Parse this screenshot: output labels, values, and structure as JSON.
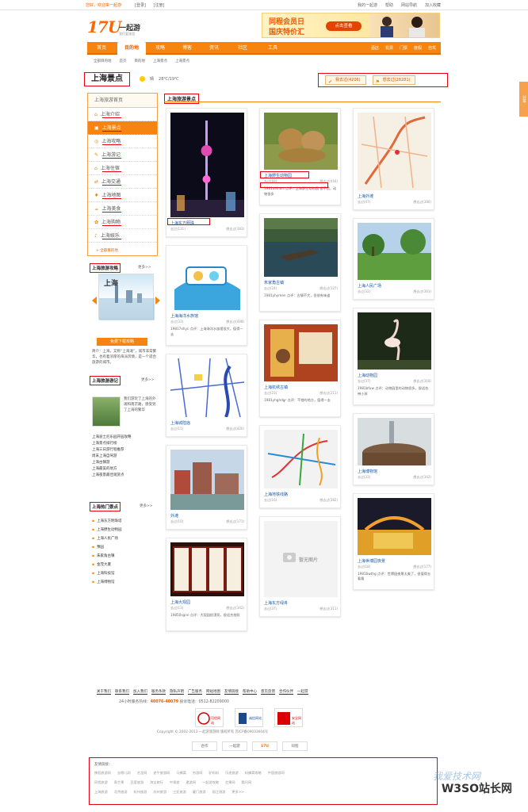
{
  "topbar": {
    "greeting": "您好，欢迎来一起游",
    "login": "[登录]",
    "register": "[注册]",
    "right_links": [
      "我的一起游",
      "帮助",
      "网站导航",
      "加入收藏"
    ]
  },
  "logo": {
    "num": "17U",
    "cn": "一起游",
    "sub": "我们爱旅游"
  },
  "ad": {
    "line1": "同程会员日",
    "line2": "国庆特价汇",
    "button": "点击查看"
  },
  "nav": {
    "items": [
      "首页",
      "目的地",
      "攻略",
      "博客",
      "资讯",
      "社区",
      "工具"
    ],
    "active": 1,
    "right_links": [
      "酒店",
      "机票",
      "门票",
      "度假",
      "自驾"
    ]
  },
  "breadcrumb": [
    "全部目的地",
    "首页",
    "目的地",
    "上海景点",
    "上海景点"
  ],
  "page_title": "上海景点",
  "weather": {
    "label": "晴",
    "temp": "28℃/19℃"
  },
  "actions": {
    "been": "我去过(4206)",
    "want": "想去过(28281)"
  },
  "sidebar": {
    "head": "上海旅游首页",
    "items": [
      {
        "icon": "home-icon",
        "glyph": "⌂",
        "label": "上海介绍"
      },
      {
        "icon": "camera-icon",
        "glyph": "▣",
        "label": "上海景点"
      },
      {
        "icon": "guide-icon",
        "glyph": "◎",
        "label": "上海攻略"
      },
      {
        "icon": "journal-icon",
        "glyph": "✎",
        "label": "上海游记"
      },
      {
        "icon": "hotel-icon",
        "glyph": "⌂",
        "label": "上海住宿"
      },
      {
        "icon": "transport-icon",
        "glyph": "⇄",
        "label": "上海交通"
      },
      {
        "icon": "map-pin-icon",
        "glyph": "♦",
        "label": "上海地图"
      },
      {
        "icon": "food-icon",
        "glyph": "☕",
        "label": "上海美食"
      },
      {
        "icon": "shopping-icon",
        "glyph": "✿",
        "label": "上海购物"
      },
      {
        "icon": "entertainment-icon",
        "glyph": "♪",
        "label": "上海娱乐"
      }
    ],
    "active": 1,
    "more": "+ 全部目的地"
  },
  "guide": {
    "title": "上海旅游攻略",
    "more": "更多>>",
    "cover_text": "上海",
    "download": "免费下载攻略",
    "desc": "简介：上海，又称“上海滩”，城市非常繁华，也有着浓厚的海派风情，是一个适合旅游的城市。"
  },
  "journal": {
    "title": "上海旅游游记",
    "more": "更多>>",
    "feature": "我们游玩了上海的外滩和南京路，感受到了上海的繁华",
    "links": [
      "上海迪士尼乐园开园攻略",
      "上海景点排行榜",
      "上海三日游行程推荐",
      "周末上海自驾游",
      "上海古镇游",
      "上海最美的地方",
      "上海夜景最佳观赏点"
    ]
  },
  "hot": {
    "title": "上海热门景点",
    "more": "更多>>",
    "links": [
      "上海东方明珠塔",
      "上海野生动物园",
      "上海人民广场",
      "豫园",
      "朱家角古镇",
      "金茂大厦",
      "上海科技馆",
      "上海博物馆"
    ]
  },
  "main_title": "上海旅游景点",
  "cards": [
    {
      "name": "上海东方明珠",
      "s1": "去过(131)",
      "s2": "想去过(383)",
      "desc": "",
      "col": 0,
      "img": "tower"
    },
    {
      "name": "上海野生动物园",
      "s1": "去过(69)",
      "s2": "想去过(416)",
      "desc": "1981deinurt 点评：上海野生动物园 很不错，动物很多",
      "col": 1,
      "img": "lions"
    },
    {
      "name": "上海外滩",
      "s1": "去过(47)",
      "s2": "想去过(380)",
      "desc": "",
      "col": 2,
      "img": "map"
    },
    {
      "name": "上海海洋水族馆",
      "s1": "去过(33)",
      "s2": "想去过(498)",
      "desc": "19817xhyc 点评：上海海洋水族馆很大，值得一去",
      "col": 0,
      "img": "aquarium"
    },
    {
      "name": "朱家角古镇",
      "s1": "去过(24)",
      "s2": "想去过(127)",
      "desc": "1981yhymen 点评：古镇不大，但很有味道",
      "col": 1,
      "img": "canal"
    },
    {
      "name": "上海人民广场",
      "s1": "去过(32)",
      "s2": "想去过(361)",
      "desc": "",
      "col": 2,
      "img": "park"
    },
    {
      "name": "上海城隍庙",
      "s1": "去过(15)",
      "s2": "想去过(420)",
      "desc": "",
      "col": 0,
      "img": "citymap"
    },
    {
      "name": "上海杭绣古镇",
      "s1": "去过(23)",
      "s2": "想去过(211)",
      "desc": "1981yhghdgr 点评：不错的地方，值得一去",
      "col": 1,
      "img": "market"
    },
    {
      "name": "上海动物园",
      "s1": "去过(37)",
      "s2": "想去过(318)",
      "desc": "1981bfuw 点评：动物园里的动物很多，很适合带小孩",
      "col": 2,
      "img": "flamingo"
    },
    {
      "name": "外滩",
      "s1": "去过(10)",
      "s2": "想去过(171)",
      "desc": "",
      "col": 0,
      "img": "bund"
    },
    {
      "name": "上海地铁线路",
      "s1": "去过(16)",
      "s2": "想去过(382)",
      "desc": "",
      "col": 1,
      "img": "metro"
    },
    {
      "name": "上海博物馆",
      "s1": "去过(33)",
      "s2": "想去过(342)",
      "desc": "",
      "col": 2,
      "img": "museum"
    },
    {
      "name": "上海大观园",
      "s1": "去过(13)",
      "s2": "想去过(342)",
      "desc": "19850sgnn 点评：大观园很漂亮，很适合拍照",
      "col": 0,
      "img": "screen"
    },
    {
      "name": "上海东方绿舟",
      "s1": "去过(37)",
      "s2": "想去过(311)",
      "desc": "",
      "col": 1,
      "img": "noimg",
      "noimg": "暂无图片"
    },
    {
      "name": "上海世博园夜景",
      "s1": "去过(18)",
      "s2": "想去过(177)",
      "desc": "1981bwthg 点评：世博园夜景太美了，很值得去看看",
      "col": 2,
      "img": "expo"
    }
  ],
  "footer": {
    "links": [
      "关于我们",
      "联系我们",
      "加入我们",
      "服务条款",
      "隐私声明",
      "广告服务",
      "网站地图",
      "友情链接",
      "帮助中心",
      "意见反馈",
      "合作伙伴",
      "一起游"
    ],
    "hotline_prefix": "24小时服务热线：",
    "hotline": "40076-40079",
    "hotline_suffix": "    投诉电话：0512-82209000",
    "badges": [
      "可信网站",
      "诚信网站",
      "安全网站"
    ],
    "copyright": "Copyright © 2002-2013 一起游旅游网 版权所有 苏ICP备09033604号",
    "partners": [
      "合作",
      "一起游",
      "17U",
      "同程"
    ],
    "flinks_title": "友情链接：",
    "flinks_rows": [
      [
        "携程旅游网",
        "去哪儿网",
        "艺龙网",
        "途牛旅游网",
        "马蜂窝",
        "穷游网",
        "驴妈妈",
        "乐途旅游",
        "蚂蜂窝攻略",
        "中国旅游网"
      ],
      [
        "同程旅游",
        "青芒果",
        "百度旅游",
        "淘宝旅行",
        "中青旅",
        "遨游网",
        "一起游攻略",
        "芒果网",
        "酷讯网"
      ],
      [
        "上海旅游",
        "北京旅游",
        "杭州旅游",
        "苏州旅游",
        "三亚旅游",
        "厦门旅游",
        "丽江旅游",
        "更多>>"
      ]
    ]
  },
  "side_tab": "分享",
  "watermark": {
    "big": "W3SO站长网",
    "small": "我爱技术网"
  }
}
